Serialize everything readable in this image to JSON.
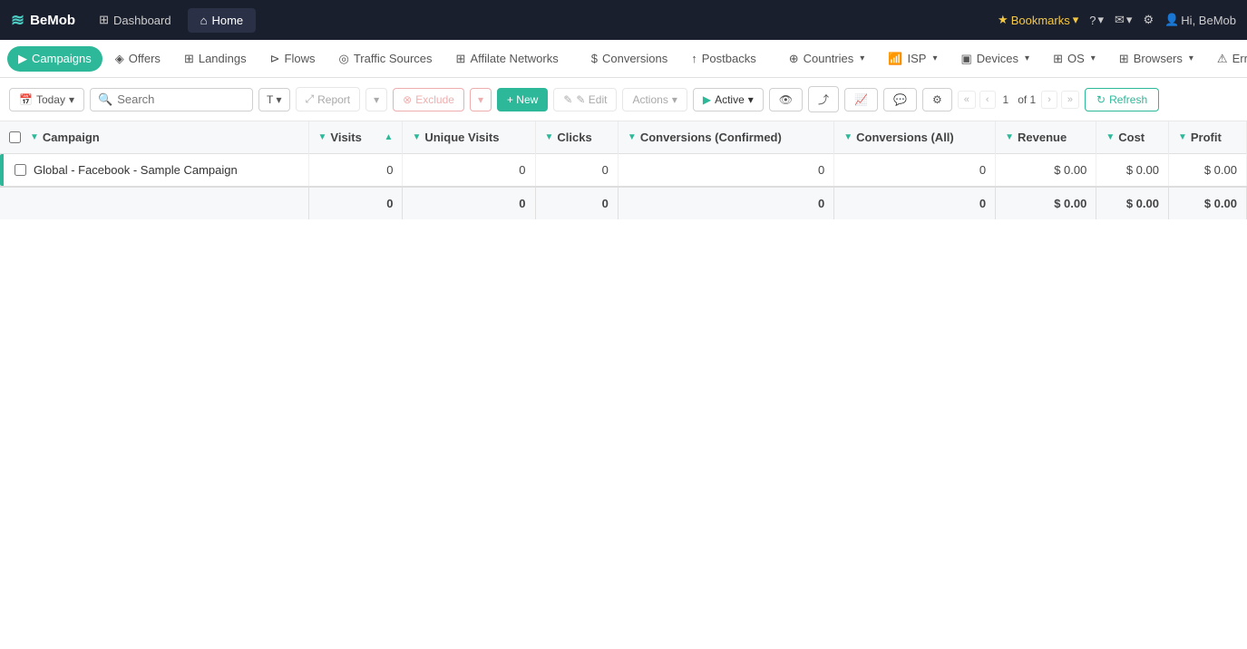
{
  "topNav": {
    "logo": "BeMob",
    "logoIcon": "≋",
    "tabs": [
      {
        "label": "Dashboard",
        "icon": "⊞",
        "active": false
      },
      {
        "label": "Home",
        "icon": "⌂",
        "active": true
      }
    ],
    "right": {
      "bookmarks": "Bookmarks",
      "help": "?",
      "messages": "✉",
      "settings": "⚙",
      "user": "Hi, BeMob"
    }
  },
  "secondNav": {
    "items": [
      {
        "label": "Campaigns",
        "icon": "▶",
        "active": true
      },
      {
        "label": "Offers",
        "icon": "◈",
        "active": false
      },
      {
        "label": "Landings",
        "icon": "⊞",
        "active": false
      },
      {
        "label": "Flows",
        "icon": "⊳",
        "active": false
      },
      {
        "label": "Traffic Sources",
        "icon": "◎",
        "active": false
      },
      {
        "label": "Affilate Networks",
        "icon": "⊞",
        "active": false
      },
      {
        "label": "Conversions",
        "icon": "$",
        "active": false
      },
      {
        "label": "Postbacks",
        "icon": "↑",
        "active": false
      },
      {
        "label": "Countries",
        "icon": "⊕",
        "active": false,
        "hasChevron": true
      },
      {
        "label": "ISP",
        "icon": "wifi",
        "active": false,
        "hasChevron": true
      },
      {
        "label": "Devices",
        "icon": "▣",
        "active": false,
        "hasChevron": true
      },
      {
        "label": "OS",
        "icon": "⊞",
        "active": false,
        "hasChevron": true
      },
      {
        "label": "Browsers",
        "icon": "⊞",
        "active": false,
        "hasChevron": true
      },
      {
        "label": "Errors",
        "icon": "⚠",
        "active": false
      }
    ]
  },
  "toolbar": {
    "today": "Today",
    "searchPlaceholder": "Search",
    "reportLabel": "Report",
    "excludeLabel": "Exclude",
    "newLabel": "+ New",
    "editLabel": "✎ Edit",
    "actionsLabel": "Actions",
    "activeLabel": "Active",
    "refreshLabel": "Refresh",
    "pageInfo": "1",
    "pageTotal": "of 1"
  },
  "table": {
    "columns": [
      {
        "label": "Campaign"
      },
      {
        "label": "Visits"
      },
      {
        "label": "Unique Visits"
      },
      {
        "label": "Clicks"
      },
      {
        "label": "Conversions (Confirmed)"
      },
      {
        "label": "Conversions (All)"
      },
      {
        "label": "Revenue"
      },
      {
        "label": "Cost"
      },
      {
        "label": "Profit"
      }
    ],
    "rows": [
      {
        "campaign": "Global - Facebook - Sample Campaign",
        "visits": "0",
        "uniqueVisits": "0",
        "clicks": "0",
        "conversionsConfirmed": "0",
        "conversionsAll": "0",
        "revenue": "$ 0.00",
        "cost": "$ 0.00",
        "profit": "$ 0.00"
      }
    ],
    "footer": {
      "visits": "0",
      "uniqueVisits": "0",
      "clicks": "0",
      "conversionsConfirmed": "0",
      "conversionsAll": "0",
      "revenue": "$ 0.00",
      "cost": "$ 0.00",
      "profit": "$ 0.00"
    }
  }
}
